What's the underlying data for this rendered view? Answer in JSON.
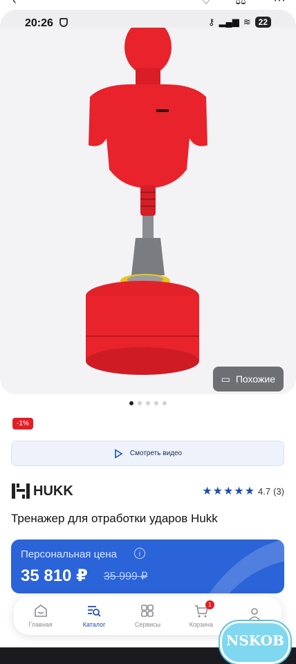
{
  "status": {
    "time": "20:26",
    "battery": "22"
  },
  "hero": {
    "similar_label": "Похожие",
    "dots_count": 5,
    "active_dot": 0
  },
  "product": {
    "discount_badge": "-1%",
    "video_label": "Смотреть видео",
    "brand": "HUKK",
    "rating_value": "4.7",
    "rating_count": "(3)",
    "stars": "★★★★★",
    "title": "Тренажер для отработки ударов Hukk"
  },
  "price": {
    "label": "Персональная цена",
    "current": "35 810 ₽",
    "old": "35 999 ₽"
  },
  "nav": {
    "items": [
      {
        "label": "Главная",
        "icon": "home-icon"
      },
      {
        "label": "Каталог",
        "icon": "catalog-icon"
      },
      {
        "label": "Сервисы",
        "icon": "services-icon"
      },
      {
        "label": "Корзина",
        "icon": "cart-icon",
        "badge": "1"
      },
      {
        "label": "",
        "icon": "profile-icon"
      }
    ],
    "active_index": 1
  },
  "watermark": "NSKOB",
  "colors": {
    "accent": "#2b63d8",
    "discount": "#e31e24",
    "product_red": "#e8232b"
  }
}
